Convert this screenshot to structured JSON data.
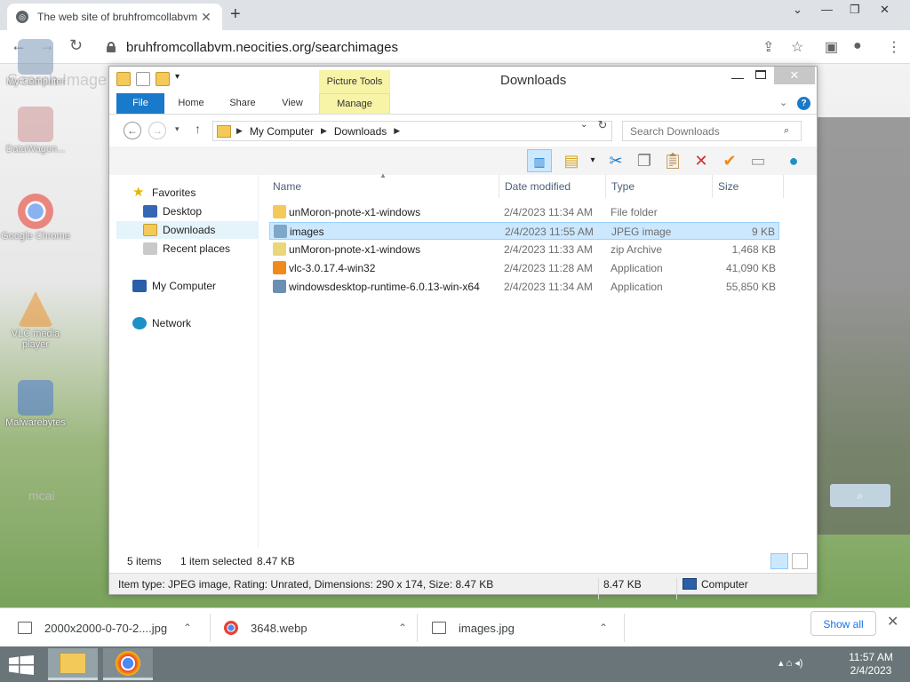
{
  "browser": {
    "tab_title": "The web site of bruhfromcollabvm",
    "url": "bruhfromcollabvm.neocities.org/searchimages"
  },
  "page": {
    "heading": "Search Image",
    "desktop_icons": [
      {
        "label": "My Computer"
      },
      {
        "label": "DataWagon..."
      },
      {
        "label": "Google Chrome"
      },
      {
        "label": "VLC media player"
      },
      {
        "label": "Malwarebytes"
      }
    ],
    "mcai": "mcai"
  },
  "explorer": {
    "window_title": "Downloads",
    "picture_tools": "Picture Tools",
    "ribbon_tabs": [
      "File",
      "Home",
      "Share",
      "View",
      "Manage"
    ],
    "path": [
      "My Computer",
      "Downloads"
    ],
    "search_placeholder": "Search Downloads",
    "nav": {
      "favorites": "Favorites",
      "desktop": "Desktop",
      "downloads": "Downloads",
      "recent": "Recent places",
      "computer": "My Computer",
      "network": "Network"
    },
    "columns": {
      "name": "Name",
      "date": "Date modified",
      "type": "Type",
      "size": "Size"
    },
    "files": [
      {
        "name": "unMoron-pnote-x1-windows",
        "date": "2/4/2023 11:34 AM",
        "type": "File folder",
        "size": "",
        "icon": "folder-icon",
        "color": "#f3c95a"
      },
      {
        "name": "images",
        "date": "2/4/2023 11:55 AM",
        "type": "JPEG image",
        "size": "9 KB",
        "icon": "image-file-icon",
        "color": "#7fa7c9"
      },
      {
        "name": "unMoron-pnote-x1-windows",
        "date": "2/4/2023 11:33 AM",
        "type": "zip Archive",
        "size": "1,468 KB",
        "icon": "zip-icon",
        "color": "#e9d77a"
      },
      {
        "name": "vlc-3.0.17.4-win32",
        "date": "2/4/2023 11:28 AM",
        "type": "Application",
        "size": "41,090 KB",
        "icon": "vlc-icon",
        "color": "#f08a1c"
      },
      {
        "name": "windowsdesktop-runtime-6.0.13-win-x64",
        "date": "2/4/2023 11:34 AM",
        "type": "Application",
        "size": "55,850 KB",
        "icon": "installer-icon",
        "color": "#6b8fb3"
      }
    ],
    "status": {
      "count": "5 items",
      "selected": "1 item selected",
      "size": "8.47 KB"
    },
    "details": {
      "info": "Item type: JPEG image, Rating: Unrated, Dimensions: 290 x 174, Size: 8.47 KB",
      "size": "8.47 KB",
      "location": "Computer"
    }
  },
  "downloads_shelf": {
    "items": [
      "2000x2000-0-70-2....jpg",
      "3648.webp",
      "images.jpg"
    ],
    "show_all": "Show all"
  },
  "taskbar": {
    "time": "11:57 AM",
    "date": "2/4/2023"
  }
}
